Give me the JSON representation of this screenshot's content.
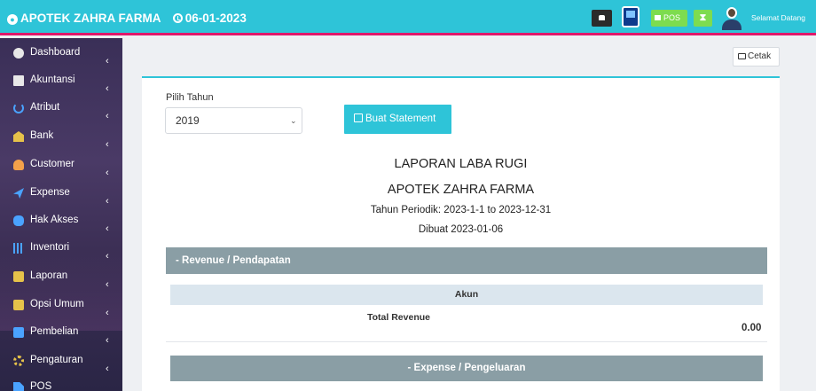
{
  "topbar": {
    "brand": "APOTEK ZAHRA FARMA",
    "date": "06-01-2023",
    "pos_label": "POS",
    "welcome": "Selamat Datang"
  },
  "sidebar": {
    "items": [
      {
        "label": "Dashboard",
        "icon": "dashboard-icon"
      },
      {
        "label": "Akuntansi",
        "icon": "calculator-icon"
      },
      {
        "label": "Atribut",
        "icon": "anchor-icon"
      },
      {
        "label": "Bank",
        "icon": "bank-icon"
      },
      {
        "label": "Customer",
        "icon": "user-icon"
      },
      {
        "label": "Expense",
        "icon": "paper-plane-icon"
      },
      {
        "label": "Hak Akses",
        "icon": "users-icon"
      },
      {
        "label": "Inventori",
        "icon": "barcode-icon"
      },
      {
        "label": "Laporan",
        "icon": "chart-icon"
      },
      {
        "label": "Opsi Umum",
        "icon": "briefcase-icon"
      },
      {
        "label": "Pembelian",
        "icon": "truck-icon"
      },
      {
        "label": "Pengaturan",
        "icon": "cog-icon"
      },
      {
        "label": "POS",
        "icon": "tag-icon"
      }
    ]
  },
  "toolbar": {
    "print_label": "Cetak"
  },
  "form": {
    "year_label": "Pilih Tahun",
    "year_value": "2019",
    "submit_label": "Buat Statement"
  },
  "report": {
    "title": "LAPORAN LABA RUGI",
    "company": "APOTEK ZAHRA FARMA",
    "period": "Tahun Periodik: 2023-1-1 to 2023-12-31",
    "created": "Dibuat 2023-01-06",
    "revenue_header": "- Revenue / Pendapatan",
    "account_header": "Akun",
    "total_revenue_label": "Total Revenue",
    "total_revenue_value": "0.00",
    "expense_header": "- Expense / Pengeluaran"
  }
}
